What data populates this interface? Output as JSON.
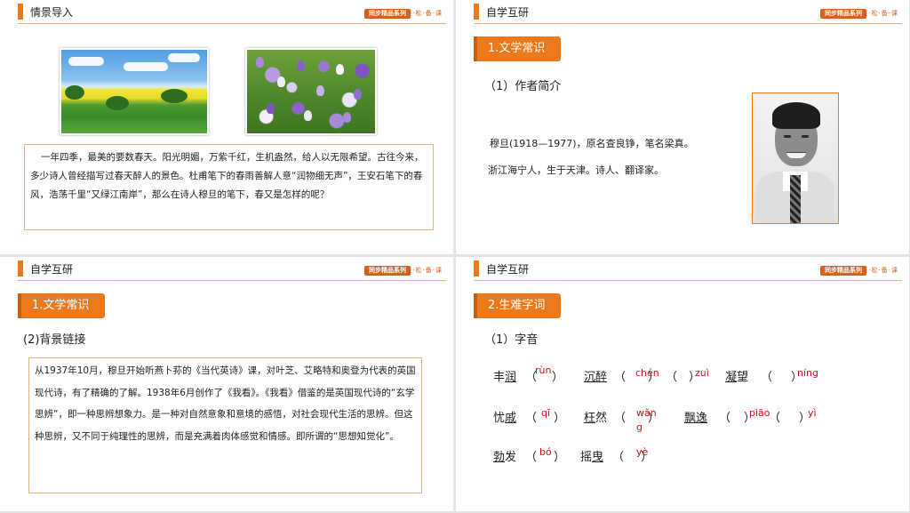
{
  "brand": {
    "series": "同步精品系列",
    "sub": "轻·松·备·课"
  },
  "slide1": {
    "header": "情景导入",
    "images": [
      "spring-field-photo",
      "crocus-flowers-photo"
    ],
    "intro": "一年四季，最美的要数春天。阳光明媚，万紫千红，生机盎然，给人以无限希望。古往今来，多少诗人曾经描写过春天醉人的景色。杜甫笔下的春雨善解人意“润物细无声”，王安石笔下的春风，浩荡千里“又绿江南岸”，那么在诗人穆旦的笔下，春又是怎样的呢？"
  },
  "slide2": {
    "header": "自学互研",
    "section": "1.文学常识",
    "subhead": "（1）作者简介",
    "line1": "穆旦(1918—1977)，原名查良铮，笔名梁真。",
    "line2": "浙江海宁人，生于天津。诗人、翻译家。"
  },
  "slide3": {
    "header": "自学互研",
    "section": "1.文学常识",
    "subhead": "(2)背景链接",
    "background": "从1937年10月，穆旦开始听燕卜荪的《当代英诗》课，对叶芝、艾略特和奥登为代表的英国现代诗，有了精确的了解。1938年6月创作了《我看》。《我看》借鉴的是英国现代诗的“玄学思辨”，即一种思辨想象力。是一种对自然意象和意境的感悟，对社会现代生活的思辨。但这种思辨，又不同于纯理性的思辨，而是充满着肉体感觉和情感。即所谓的“思想知觉化”。"
  },
  "slide4": {
    "header": "自学互研",
    "section": "2.生难字词",
    "subhead": "（1）字音",
    "open_paren": "（",
    "close_paren": "）",
    "words": {
      "w1": {
        "plain": "丰",
        "marked": "润",
        "pinyin": "rùn"
      },
      "w2": {
        "marked": "沉醉",
        "pinyin_a": "chén",
        "pinyin_b": "zuì"
      },
      "w3": {
        "marked": "凝",
        "plain": "望",
        "pinyin": "níng"
      },
      "w4": {
        "plain": "忧",
        "marked": "戚",
        "pinyin": "qī"
      },
      "w5": {
        "marked": "枉",
        "plain": "然",
        "pinyin_a": "wǎn",
        "pinyin_b": "g"
      },
      "w6": {
        "marked": "飘逸",
        "pinyin_a": "piāo",
        "pinyin_b": "yì"
      },
      "w7": {
        "marked": "勃",
        "plain": "发",
        "pinyin": "bó"
      },
      "w8": {
        "plain": "摇",
        "marked": "曳",
        "pinyin": "yè"
      }
    }
  }
}
